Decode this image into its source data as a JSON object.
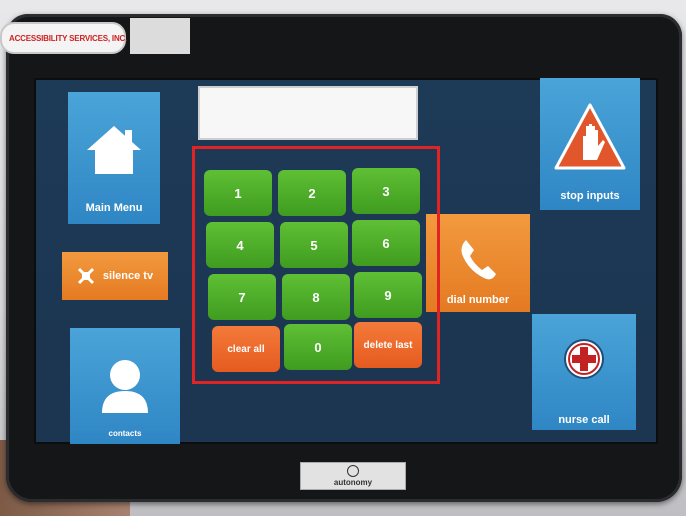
{
  "device": {
    "sticker_text": "ACCESSIBILITY SERVICES, INC.",
    "brand_badge": "autonomy"
  },
  "screen": {
    "display_value": "",
    "main_menu": {
      "label": "Main Menu",
      "icon": "home-icon"
    },
    "silence_tv": {
      "label": "silence tv",
      "icon": "mute-icon"
    },
    "contacts": {
      "label": "contacts",
      "icon": "person-icon"
    },
    "stop_inputs": {
      "label": "stop inputs",
      "icon": "stop-hand-icon"
    },
    "dial_number": {
      "label": "dial number",
      "icon": "phone-icon"
    },
    "nurse_call": {
      "label": "nurse call",
      "icon": "medical-cross-icon"
    },
    "keypad": {
      "keys": [
        "1",
        "2",
        "3",
        "4",
        "5",
        "6",
        "7",
        "8",
        "9"
      ],
      "clear_all": "clear all",
      "zero": "0",
      "delete_last": "delete last"
    }
  },
  "colors": {
    "tile_blue": "#3a95d0",
    "tile_orange": "#ea8a2e",
    "key_green": "#4fae29",
    "key_red": "#e9662a",
    "highlight": "#e02424"
  }
}
